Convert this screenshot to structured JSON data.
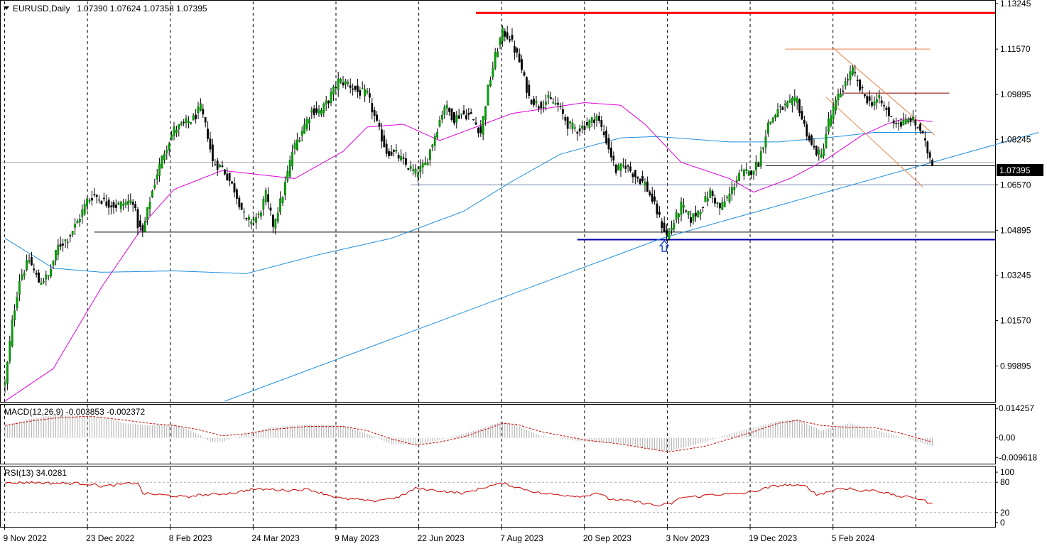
{
  "chart_data": [
    {
      "type": "candlestick",
      "title": "EURUSD,Daily",
      "ohlc_label": "1.07390 1.07624 1.07358 1.07395",
      "current_price": 1.07395,
      "current_price_label": "1.07395",
      "ylim": [
        0.986,
        1.133
      ],
      "y_ticks": [
        1.13245,
        1.1157,
        1.09895,
        1.08245,
        1.0657,
        1.04895,
        1.03245,
        1.0157,
        0.99895
      ],
      "y_tick_labels": [
        "1.13245",
        "1.11570",
        "1.09895",
        "1.08245",
        "1.06570",
        "1.04895",
        "1.03245",
        "1.01570",
        "0.99895"
      ],
      "x_tick_labels": [
        "9 Nov 2022",
        "23 Dec 2022",
        "8 Feb 2023",
        "24 Mar 2023",
        "9 May 2023",
        "22 Jun 2023",
        "7 Aug 2023",
        "20 Sep 2023",
        "3 Nov 2023",
        "19 Dec 2023",
        "5 Feb 2024"
      ],
      "grid": "vertical-dashed",
      "close_anchors": [
        [
          0,
          0.992
        ],
        [
          3,
          1.015
        ],
        [
          6,
          1.031
        ],
        [
          10,
          1.038
        ],
        [
          14,
          1.03
        ],
        [
          18,
          1.032
        ],
        [
          22,
          1.043
        ],
        [
          26,
          1.046
        ],
        [
          30,
          1.052
        ],
        [
          34,
          1.06
        ],
        [
          37,
          1.062
        ],
        [
          42,
          1.059
        ],
        [
          46,
          1.058
        ],
        [
          50,
          1.059
        ],
        [
          53,
          1.06
        ],
        [
          55,
          1.051
        ],
        [
          57,
          1.048
        ],
        [
          60,
          1.06
        ],
        [
          63,
          1.07
        ],
        [
          66,
          1.078
        ],
        [
          70,
          1.086
        ],
        [
          74,
          1.088
        ],
        [
          78,
          1.09
        ],
        [
          81,
          1.094
        ],
        [
          84,
          1.084
        ],
        [
          86,
          1.074
        ],
        [
          90,
          1.072
        ],
        [
          95,
          1.064
        ],
        [
          100,
          1.052
        ],
        [
          105,
          1.054
        ],
        [
          108,
          1.062
        ],
        [
          111,
          1.051
        ],
        [
          115,
          1.062
        ],
        [
          119,
          1.078
        ],
        [
          123,
          1.086
        ],
        [
          127,
          1.093
        ],
        [
          131,
          1.093
        ],
        [
          134,
          1.097
        ],
        [
          138,
          1.104
        ],
        [
          142,
          1.103
        ],
        [
          146,
          1.1
        ],
        [
          150,
          1.099
        ],
        [
          154,
          1.088
        ],
        [
          158,
          1.078
        ],
        [
          162,
          1.077
        ],
        [
          166,
          1.073
        ],
        [
          170,
          1.07
        ],
        [
          174,
          1.073
        ],
        [
          178,
          1.084
        ],
        [
          182,
          1.095
        ],
        [
          186,
          1.09
        ],
        [
          189,
          1.092
        ],
        [
          193,
          1.091
        ],
        [
          197,
          1.085
        ],
        [
          200,
          1.101
        ],
        [
          203,
          1.113
        ],
        [
          206,
          1.122
        ],
        [
          209,
          1.12
        ],
        [
          213,
          1.111
        ],
        [
          217,
          1.098
        ],
        [
          221,
          1.095
        ],
        [
          225,
          1.097
        ],
        [
          229,
          1.095
        ],
        [
          233,
          1.088
        ],
        [
          237,
          1.086
        ],
        [
          241,
          1.088
        ],
        [
          245,
          1.091
        ],
        [
          249,
          1.082
        ],
        [
          253,
          1.071
        ],
        [
          257,
          1.073
        ],
        [
          261,
          1.069
        ],
        [
          265,
          1.066
        ],
        [
          269,
          1.058
        ],
        [
          272,
          1.051
        ],
        [
          274,
          1.047
        ],
        [
          276,
          1.05
        ],
        [
          280,
          1.058
        ],
        [
          284,
          1.053
        ],
        [
          288,
          1.057
        ],
        [
          292,
          1.063
        ],
        [
          296,
          1.057
        ],
        [
          300,
          1.062
        ],
        [
          304,
          1.07
        ],
        [
          308,
          1.07
        ],
        [
          312,
          1.074
        ],
        [
          316,
          1.088
        ],
        [
          320,
          1.093
        ],
        [
          324,
          1.095
        ],
        [
          328,
          1.097
        ],
        [
          330,
          1.09
        ],
        [
          334,
          1.08
        ],
        [
          338,
          1.076
        ],
        [
          341,
          1.089
        ],
        [
          345,
          1.098
        ],
        [
          349,
          1.105
        ],
        [
          351,
          1.108
        ],
        [
          354,
          1.101
        ],
        [
          358,
          1.096
        ],
        [
          362,
          1.097
        ],
        [
          365,
          1.093
        ],
        [
          367,
          1.09
        ],
        [
          371,
          1.088
        ],
        [
          375,
          1.09
        ],
        [
          379,
          1.086
        ],
        [
          382,
          1.078
        ],
        [
          384,
          1.074
        ]
      ],
      "ma_50_anchors": [
        [
          0,
          0.986
        ],
        [
          20,
          0.998
        ],
        [
          40,
          1.028
        ],
        [
          60,
          1.054
        ],
        [
          70,
          1.064
        ],
        [
          90,
          1.071
        ],
        [
          110,
          1.069
        ],
        [
          120,
          1.068
        ],
        [
          140,
          1.078
        ],
        [
          150,
          1.087
        ],
        [
          165,
          1.088
        ],
        [
          180,
          1.082
        ],
        [
          210,
          1.092
        ],
        [
          240,
          1.096
        ],
        [
          255,
          1.095
        ],
        [
          265,
          1.088
        ],
        [
          280,
          1.074
        ],
        [
          300,
          1.068
        ],
        [
          310,
          1.063
        ],
        [
          325,
          1.068
        ],
        [
          340,
          1.075
        ],
        [
          355,
          1.084
        ],
        [
          365,
          1.088
        ],
        [
          372,
          1.09
        ],
        [
          384,
          1.089
        ]
      ],
      "ma_200_anchors": [
        [
          0,
          1.046
        ],
        [
          20,
          1.035
        ],
        [
          40,
          1.0335
        ],
        [
          70,
          1.034
        ],
        [
          100,
          1.033
        ],
        [
          130,
          1.04
        ],
        [
          160,
          1.046
        ],
        [
          190,
          1.056
        ],
        [
          210,
          1.067
        ],
        [
          230,
          1.077
        ],
        [
          255,
          1.083
        ],
        [
          270,
          1.0835
        ],
        [
          285,
          1.0825
        ],
        [
          300,
          1.0815
        ],
        [
          320,
          1.0815
        ],
        [
          340,
          1.083
        ],
        [
          360,
          1.085
        ],
        [
          384,
          1.085
        ]
      ],
      "trendline": {
        "points": [
          [
            91,
            0.986
          ],
          [
            272,
            1.046
          ],
          [
            384,
            1.074
          ],
          [
            428,
            1.085
          ]
        ]
      },
      "h_lines": [
        {
          "value": 1.129,
          "x_from": 195,
          "x_to": 410,
          "color": "#ff0000",
          "width": 3
        },
        {
          "value": 1.1157,
          "x_from": 323,
          "x_to": 383,
          "color": "#e8814a",
          "width": 1
        },
        {
          "value": 1.0995,
          "x_from": 347,
          "x_to": 391,
          "color": "#8b0000",
          "width": 1
        },
        {
          "value": 1.0727,
          "x_from": 315,
          "x_to": 410,
          "color": "#000000",
          "width": 1
        },
        {
          "value": 1.0657,
          "x_from": 168,
          "x_to": 410,
          "color": "#7788aa",
          "width": 1
        },
        {
          "value": 1.0483,
          "x_from": 37,
          "x_to": 410,
          "color": "#000000",
          "width": 1
        },
        {
          "value": 1.0455,
          "x_from": 237,
          "x_to": 410,
          "color": "#0000aa",
          "width": 2
        }
      ],
      "h_line_current": {
        "value": 1.07395,
        "color": "#aaaaaa"
      },
      "channel_lines": [
        {
          "points": [
            [
              343,
              1.116
            ],
            [
              385,
              1.084
            ]
          ],
          "color": "#e8814a"
        },
        {
          "points": [
            [
              340,
              1.098
            ],
            [
              380,
              1.065
            ]
          ],
          "color": "#e8814a"
        }
      ],
      "arrow_marker": {
        "x": 273,
        "value": 1.043,
        "color": "#0033cc"
      },
      "colors": {
        "bull": "#00a000",
        "bear": "#000000",
        "ma_50": "#e000e0",
        "ma_200": "#1f8fdf",
        "trendline": "#1f8fdf",
        "grid": "#000000"
      }
    },
    {
      "type": "histogram",
      "title": "MACD(12,26,9) -0.003853 -0.002372",
      "y_ticks": [
        0.014257,
        0.0,
        -0.009618
      ],
      "y_tick_labels": [
        "0.014257",
        "0.00",
        "-0.009618"
      ],
      "ylim": [
        -0.0118,
        0.015
      ],
      "hist_anchors": [
        [
          0,
          0.006
        ],
        [
          10,
          0.009
        ],
        [
          20,
          0.011
        ],
        [
          30,
          0.011
        ],
        [
          40,
          0.01
        ],
        [
          50,
          0.007
        ],
        [
          60,
          0.006
        ],
        [
          70,
          0.0065
        ],
        [
          80,
          0.002
        ],
        [
          85,
          -0.002
        ],
        [
          90,
          -0.002
        ],
        [
          100,
          0.002
        ],
        [
          110,
          0.005
        ],
        [
          125,
          0.0065
        ],
        [
          140,
          0.006
        ],
        [
          150,
          0.002
        ],
        [
          160,
          -0.003
        ],
        [
          170,
          -0.0035
        ],
        [
          180,
          -0.001
        ],
        [
          190,
          0.002
        ],
        [
          200,
          0.0055
        ],
        [
          206,
          0.008
        ],
        [
          212,
          0.006
        ],
        [
          222,
          0.001
        ],
        [
          240,
          -0.002
        ],
        [
          255,
          -0.0025
        ],
        [
          265,
          -0.005
        ],
        [
          275,
          -0.0065
        ],
        [
          290,
          -0.002
        ],
        [
          300,
          0.002
        ],
        [
          310,
          0.005
        ],
        [
          320,
          0.008
        ],
        [
          328,
          0.009
        ],
        [
          338,
          0.0035
        ],
        [
          350,
          0.007
        ],
        [
          360,
          0.004
        ],
        [
          370,
          0.001
        ],
        [
          384,
          -0.004
        ]
      ],
      "signal_anchors": [
        [
          0,
          0.006
        ],
        [
          10,
          0.008
        ],
        [
          20,
          0.0095
        ],
        [
          35,
          0.0105
        ],
        [
          50,
          0.0085
        ],
        [
          60,
          0.007
        ],
        [
          70,
          0.006
        ],
        [
          80,
          0.004
        ],
        [
          90,
          0.001
        ],
        [
          100,
          0.002
        ],
        [
          110,
          0.004
        ],
        [
          125,
          0.0055
        ],
        [
          140,
          0.0055
        ],
        [
          150,
          0.0035
        ],
        [
          160,
          -0.0005
        ],
        [
          170,
          -0.0035
        ],
        [
          180,
          -0.002
        ],
        [
          190,
          0.0005
        ],
        [
          200,
          0.0045
        ],
        [
          206,
          0.007
        ],
        [
          212,
          0.0065
        ],
        [
          222,
          0.003
        ],
        [
          240,
          -0.001
        ],
        [
          255,
          -0.003
        ],
        [
          265,
          -0.005
        ],
        [
          275,
          -0.0068
        ],
        [
          290,
          -0.004
        ],
        [
          300,
          -0.0005
        ],
        [
          310,
          0.003
        ],
        [
          320,
          0.007
        ],
        [
          328,
          0.0085
        ],
        [
          338,
          0.006
        ],
        [
          350,
          0.005
        ],
        [
          360,
          0.005
        ],
        [
          370,
          0.0025
        ],
        [
          384,
          -0.002
        ]
      ],
      "hist_color": "#b0b0b0",
      "signal_color": "#cc0000"
    },
    {
      "type": "line",
      "title": "RSI(13) 34.0281",
      "y_ticks": [
        100,
        80,
        20,
        0
      ],
      "y_tick_labels": [
        "100",
        "80",
        "20",
        "0"
      ],
      "ylim": [
        0,
        100
      ],
      "levels": [
        80,
        20
      ],
      "rsi_anchors": [
        [
          0,
          78
        ],
        [
          10,
          80
        ],
        [
          20,
          78
        ],
        [
          30,
          78
        ],
        [
          36,
          76
        ],
        [
          40,
          72
        ],
        [
          45,
          74
        ],
        [
          50,
          77
        ],
        [
          55,
          79
        ],
        [
          57,
          58
        ],
        [
          62,
          56
        ],
        [
          70,
          53
        ],
        [
          76,
          50
        ],
        [
          78,
          54
        ],
        [
          90,
          57
        ],
        [
          96,
          60
        ],
        [
          102,
          66
        ],
        [
          110,
          66
        ],
        [
          116,
          64
        ],
        [
          126,
          66
        ],
        [
          130,
          60
        ],
        [
          140,
          47
        ],
        [
          146,
          46
        ],
        [
          152,
          42
        ],
        [
          156,
          46
        ],
        [
          163,
          50
        ],
        [
          170,
          68
        ],
        [
          180,
          63
        ],
        [
          190,
          58
        ],
        [
          200,
          72
        ],
        [
          206,
          78
        ],
        [
          212,
          70
        ],
        [
          222,
          58
        ],
        [
          230,
          55
        ],
        [
          240,
          52
        ],
        [
          245,
          60
        ],
        [
          250,
          47
        ],
        [
          260,
          42
        ],
        [
          266,
          38
        ],
        [
          270,
          33
        ],
        [
          276,
          38
        ],
        [
          280,
          50
        ],
        [
          288,
          52
        ],
        [
          292,
          56
        ],
        [
          300,
          56
        ],
        [
          306,
          58
        ],
        [
          312,
          64
        ],
        [
          318,
          72
        ],
        [
          324,
          75
        ],
        [
          328,
          73
        ],
        [
          332,
          72
        ],
        [
          336,
          55
        ],
        [
          340,
          60
        ],
        [
          345,
          67
        ],
        [
          350,
          68
        ],
        [
          354,
          62
        ],
        [
          360,
          65
        ],
        [
          370,
          52
        ],
        [
          376,
          50
        ],
        [
          380,
          45
        ],
        [
          384,
          36
        ]
      ],
      "line_color": "#cc0000"
    }
  ]
}
